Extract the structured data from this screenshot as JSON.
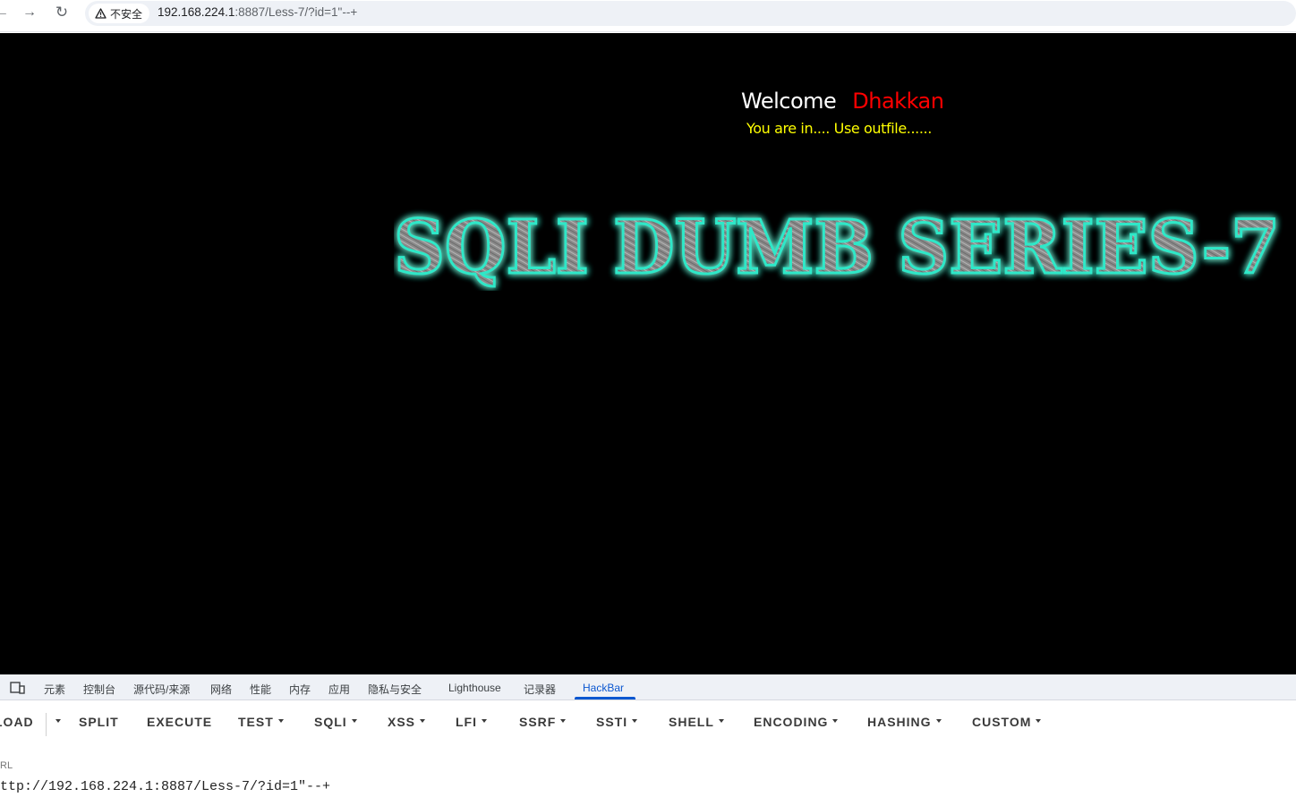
{
  "browser": {
    "security_chip": "不安全",
    "url_host": "192.168.224.1",
    "url_rest": ":8887/Less-7/?id=1\"--+",
    "icons": {
      "back": "back-arrow-icon",
      "forward": "forward-arrow-icon",
      "reload": "reload-icon",
      "warning": "warning-triangle-icon"
    }
  },
  "page": {
    "welcome_word": "Welcome",
    "welcome_name": "Dhakkan",
    "status_message": "You are in.... Use outfile......",
    "banner_text": "SQLI DUMB SERIES-7",
    "colors": {
      "background": "#000000",
      "welcome": "#ffffff",
      "name": "#ff0000",
      "status": "#ffff00",
      "banner_glow": "#2ee8c8"
    }
  },
  "devtools": {
    "tabs": [
      "元素",
      "控制台",
      "源代码/来源",
      "网络",
      "性能",
      "内存",
      "应用",
      "隐私与安全",
      "Lighthouse",
      "记录器",
      "HackBar"
    ],
    "active_tab": "HackBar",
    "accent": "#0b57d0"
  },
  "hackbar": {
    "buttons": [
      "LOAD",
      "SPLIT",
      "EXECUTE",
      "TEST",
      "SQLI",
      "XSS",
      "LFI",
      "SSRF",
      "SSTI",
      "SHELL",
      "ENCODING",
      "HASHING",
      "CUSTOM"
    ],
    "dropdown_buttons": [
      "TEST",
      "SQLI",
      "XSS",
      "LFI",
      "SSRF",
      "SSTI",
      "SHELL",
      "ENCODING",
      "HASHING",
      "CUSTOM"
    ],
    "url_label": "RL",
    "url_value": "ttp://192.168.224.1:8887/Less-7/?id=1\"--+"
  }
}
